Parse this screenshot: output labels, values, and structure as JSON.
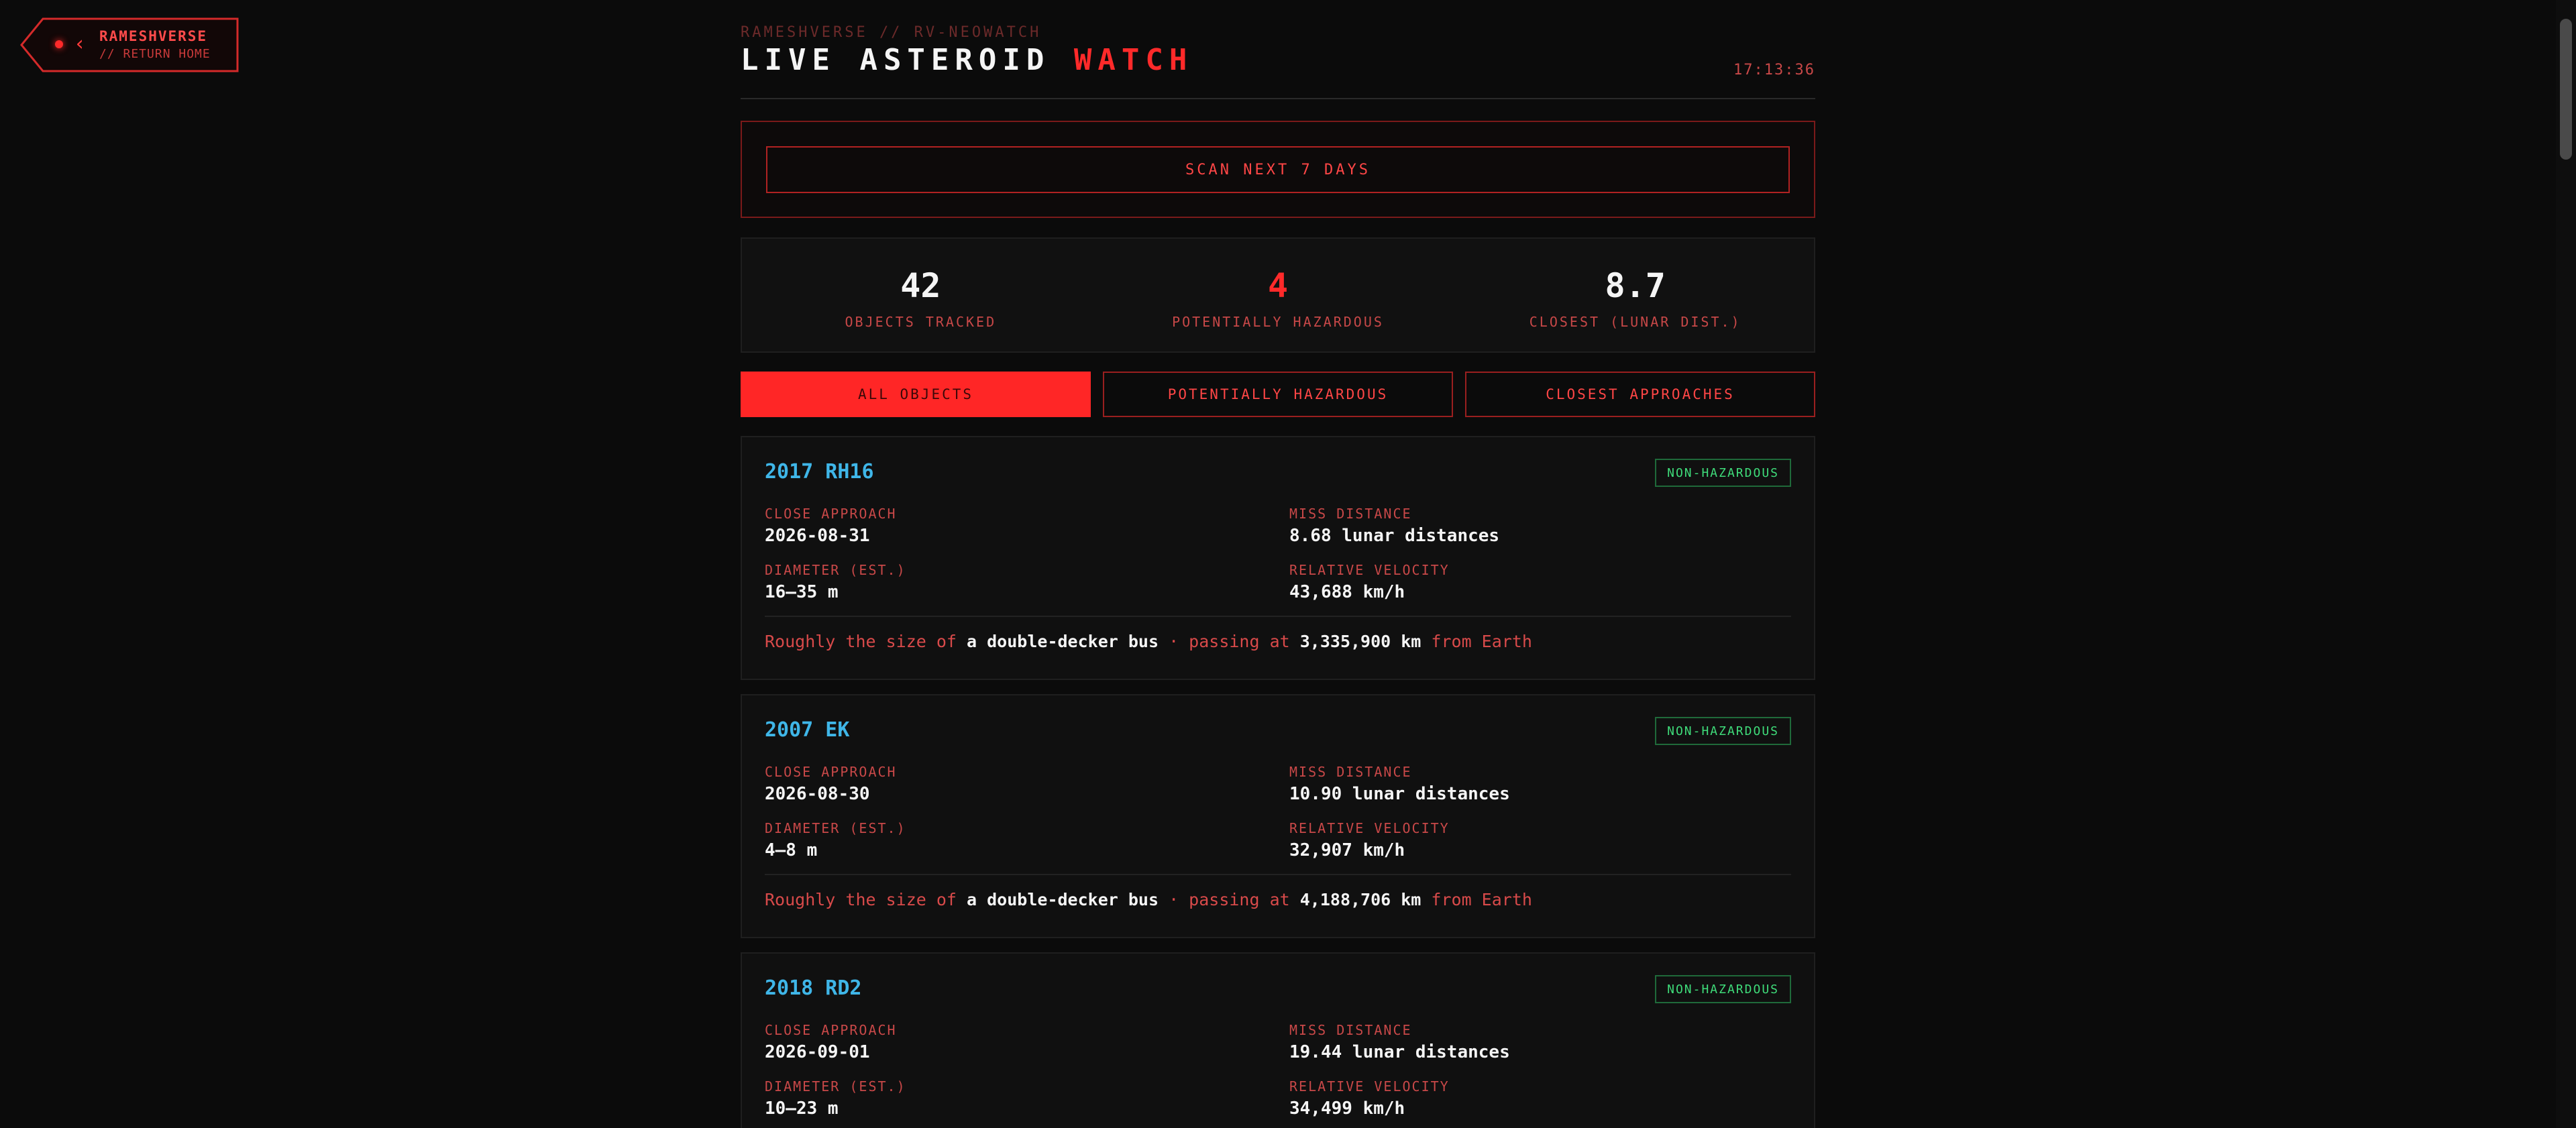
{
  "back": {
    "title": "RAMESHVERSE",
    "subtitle": "// RETURN HOME",
    "chevron": "‹"
  },
  "header": {
    "kicker": "RAMESHVERSE // RV-NEOWATCH",
    "title_main": "LIVE ASTEROID ",
    "title_accent": "WATCH",
    "clock": "17:13:36"
  },
  "scan": {
    "label": "SCAN NEXT 7 DAYS"
  },
  "stats": [
    {
      "value": "42",
      "label": "OBJECTS TRACKED"
    },
    {
      "value": "4",
      "label": "POTENTIALLY HAZARDOUS"
    },
    {
      "value": "8.7",
      "label": "CLOSEST (LUNAR DIST.)"
    }
  ],
  "filters": [
    {
      "label": "ALL OBJECTS",
      "active": true
    },
    {
      "label": "POTENTIALLY HAZARDOUS",
      "active": false
    },
    {
      "label": "CLOSEST APPROACHES",
      "active": false
    }
  ],
  "labels": {
    "close_approach": "CLOSE APPROACH",
    "miss_distance": "MISS DISTANCE",
    "diameter": "DIAMETER (EST.)",
    "velocity": "RELATIVE VELOCITY",
    "summary_a": "Roughly the size of ",
    "summary_b": " · passing at ",
    "summary_c": " from Earth"
  },
  "asteroids": [
    {
      "name": "2017 RH16",
      "badge": "NON-HAZARDOUS",
      "close_approach": "2026-08-31",
      "miss_distance": "8.68 lunar distances",
      "diameter": "16–35 m",
      "velocity": "43,688 km/h",
      "size_compare": "a double-decker bus",
      "passing_km": "3,335,900 km"
    },
    {
      "name": "2007 EK",
      "badge": "NON-HAZARDOUS",
      "close_approach": "2026-08-30",
      "miss_distance": "10.90 lunar distances",
      "diameter": "4–8 m",
      "velocity": "32,907 km/h",
      "size_compare": "a double-decker bus",
      "passing_km": "4,188,706 km"
    },
    {
      "name": "2018 RD2",
      "badge": "NON-HAZARDOUS",
      "close_approach": "2026-09-01",
      "miss_distance": "19.44 lunar distances",
      "diameter": "10–23 m",
      "velocity": "34,499 km/h",
      "size_compare": "",
      "passing_km": ""
    }
  ],
  "colors": {
    "accent": "#ff2a2a",
    "name": "#3fb6e8",
    "safe": "#3fdc7a",
    "bg": "#0b0b0b"
  }
}
